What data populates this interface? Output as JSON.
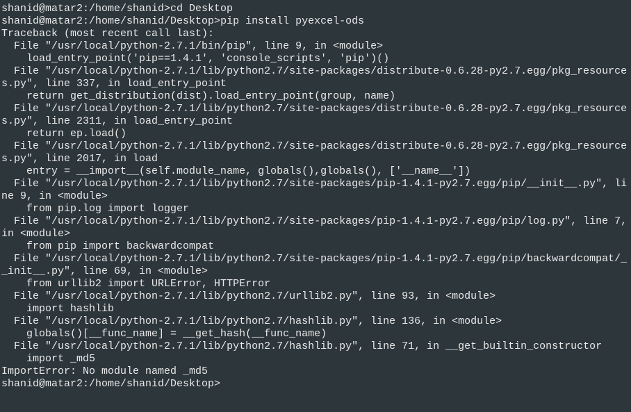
{
  "terminal": {
    "lines": [
      {
        "type": "prompt",
        "prompt": "shanid@matar2:/home/shanid>",
        "cmd": "cd Desktop"
      },
      {
        "type": "prompt",
        "prompt": "shanid@matar2:/home/shanid/Desktop>",
        "cmd": "pip install pyexcel-ods"
      },
      {
        "type": "out",
        "text": "Traceback (most recent call last):"
      },
      {
        "type": "out",
        "text": "  File \"/usr/local/python-2.7.1/bin/pip\", line 9, in <module>"
      },
      {
        "type": "out",
        "text": "    load_entry_point('pip==1.4.1', 'console_scripts', 'pip')()"
      },
      {
        "type": "out",
        "text": "  File \"/usr/local/python-2.7.1/lib/python2.7/site-packages/distribute-0.6.28-py2.7.egg/pkg_resources.py\", line 337, in load_entry_point"
      },
      {
        "type": "out",
        "text": "    return get_distribution(dist).load_entry_point(group, name)"
      },
      {
        "type": "out",
        "text": "  File \"/usr/local/python-2.7.1/lib/python2.7/site-packages/distribute-0.6.28-py2.7.egg/pkg_resources.py\", line 2311, in load_entry_point"
      },
      {
        "type": "out",
        "text": "    return ep.load()"
      },
      {
        "type": "out",
        "text": "  File \"/usr/local/python-2.7.1/lib/python2.7/site-packages/distribute-0.6.28-py2.7.egg/pkg_resources.py\", line 2017, in load"
      },
      {
        "type": "out",
        "text": "    entry = __import__(self.module_name, globals(),globals(), ['__name__'])"
      },
      {
        "type": "out",
        "text": "  File \"/usr/local/python-2.7.1/lib/python2.7/site-packages/pip-1.4.1-py2.7.egg/pip/__init__.py\", line 9, in <module>"
      },
      {
        "type": "out",
        "text": "    from pip.log import logger"
      },
      {
        "type": "out",
        "text": "  File \"/usr/local/python-2.7.1/lib/python2.7/site-packages/pip-1.4.1-py2.7.egg/pip/log.py\", line 7, in <module>"
      },
      {
        "type": "out",
        "text": "    from pip import backwardcompat"
      },
      {
        "type": "out",
        "text": "  File \"/usr/local/python-2.7.1/lib/python2.7/site-packages/pip-1.4.1-py2.7.egg/pip/backwardcompat/__init__.py\", line 69, in <module>"
      },
      {
        "type": "out",
        "text": "    from urllib2 import URLError, HTTPError"
      },
      {
        "type": "out",
        "text": "  File \"/usr/local/python-2.7.1/lib/python2.7/urllib2.py\", line 93, in <module>"
      },
      {
        "type": "out",
        "text": "    import hashlib"
      },
      {
        "type": "out",
        "text": "  File \"/usr/local/python-2.7.1/lib/python2.7/hashlib.py\", line 136, in <module>"
      },
      {
        "type": "out",
        "text": "    globals()[__func_name] = __get_hash(__func_name)"
      },
      {
        "type": "out",
        "text": "  File \"/usr/local/python-2.7.1/lib/python2.7/hashlib.py\", line 71, in __get_builtin_constructor"
      },
      {
        "type": "out",
        "text": "    import _md5"
      },
      {
        "type": "out",
        "text": "ImportError: No module named _md5"
      },
      {
        "type": "prompt",
        "prompt": "shanid@matar2:/home/shanid/Desktop>",
        "cmd": ""
      }
    ]
  },
  "colors": {
    "background": "#2d363b",
    "foreground": "#e8e8e8"
  }
}
